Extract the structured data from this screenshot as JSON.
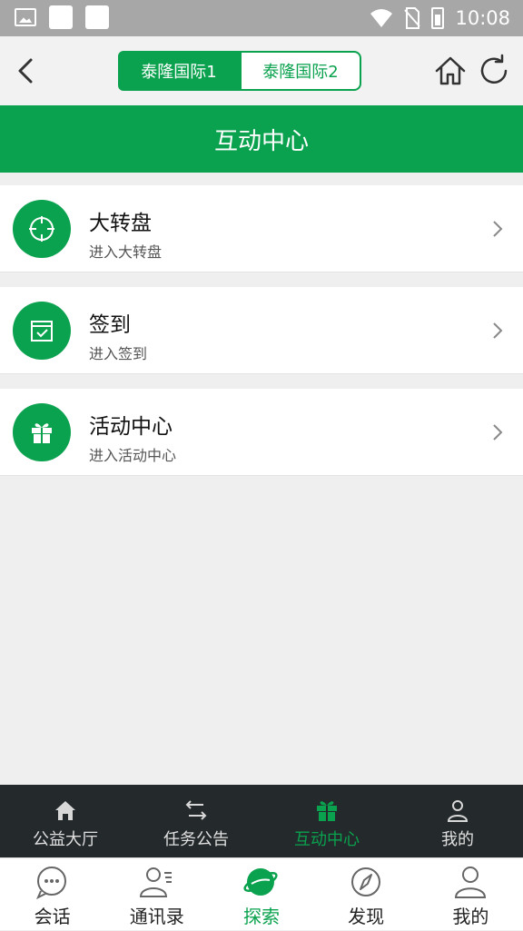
{
  "status_bar": {
    "time": "10:08"
  },
  "header": {
    "tabs": [
      {
        "label": "泰隆国际1",
        "active": true
      },
      {
        "label": "泰隆国际2",
        "active": false
      }
    ]
  },
  "title": "互动中心",
  "list": [
    {
      "title": "大转盘",
      "subtitle": "进入大转盘",
      "icon": "crosshair-icon"
    },
    {
      "title": "签到",
      "subtitle": "进入签到",
      "icon": "calendar-check-icon"
    },
    {
      "title": "活动中心",
      "subtitle": "进入活动中心",
      "icon": "gift-icon"
    }
  ],
  "inner_nav": [
    {
      "label": "公益大厅",
      "icon": "home-icon",
      "active": false
    },
    {
      "label": "任务公告",
      "icon": "swap-icon",
      "active": false
    },
    {
      "label": "互动中心",
      "icon": "gift-icon",
      "active": true
    },
    {
      "label": "我的",
      "icon": "user-icon",
      "active": false
    }
  ],
  "outer_nav": [
    {
      "label": "会话",
      "icon": "chat-icon",
      "active": false
    },
    {
      "label": "通讯录",
      "icon": "contacts-icon",
      "active": false
    },
    {
      "label": "探索",
      "icon": "planet-icon",
      "active": true
    },
    {
      "label": "发现",
      "icon": "compass-icon",
      "active": false
    },
    {
      "label": "我的",
      "icon": "user-icon",
      "active": false
    }
  ],
  "colors": {
    "accent": "#0aa24e",
    "inner_nav_bg": "#24292c",
    "status_bar_bg": "#a7a7a7"
  }
}
